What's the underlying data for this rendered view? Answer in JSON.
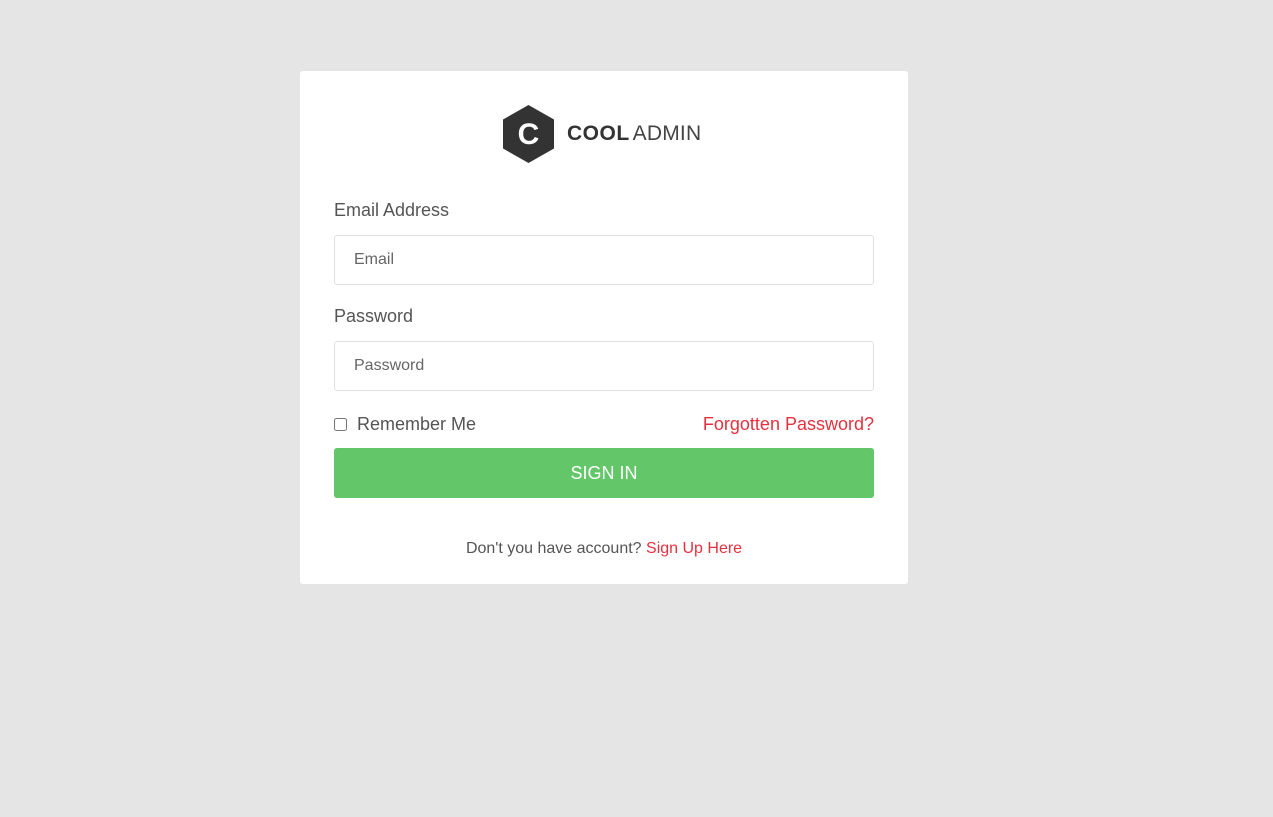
{
  "logo": {
    "letter": "C",
    "brand_bold": "COOL",
    "brand_light": "ADMIN"
  },
  "form": {
    "email_label": "Email Address",
    "email_placeholder": "Email",
    "email_value": "",
    "password_label": "Password",
    "password_placeholder": "Password",
    "password_value": "",
    "remember_label": "Remember Me",
    "remember_checked": false,
    "forgot_link": "Forgotten Password?",
    "submit_label": "SIGN IN"
  },
  "footer": {
    "prompt": "Don't you have account?",
    "signup_link": "Sign Up Here"
  },
  "colors": {
    "page_background": "#e5e5e5",
    "card_background": "#ffffff",
    "accent_link": "#e5313d",
    "button_green": "#63c76a",
    "logo_dark": "#333333"
  },
  "icons": {
    "logo_mark": "hexagon-c-logo-icon"
  }
}
